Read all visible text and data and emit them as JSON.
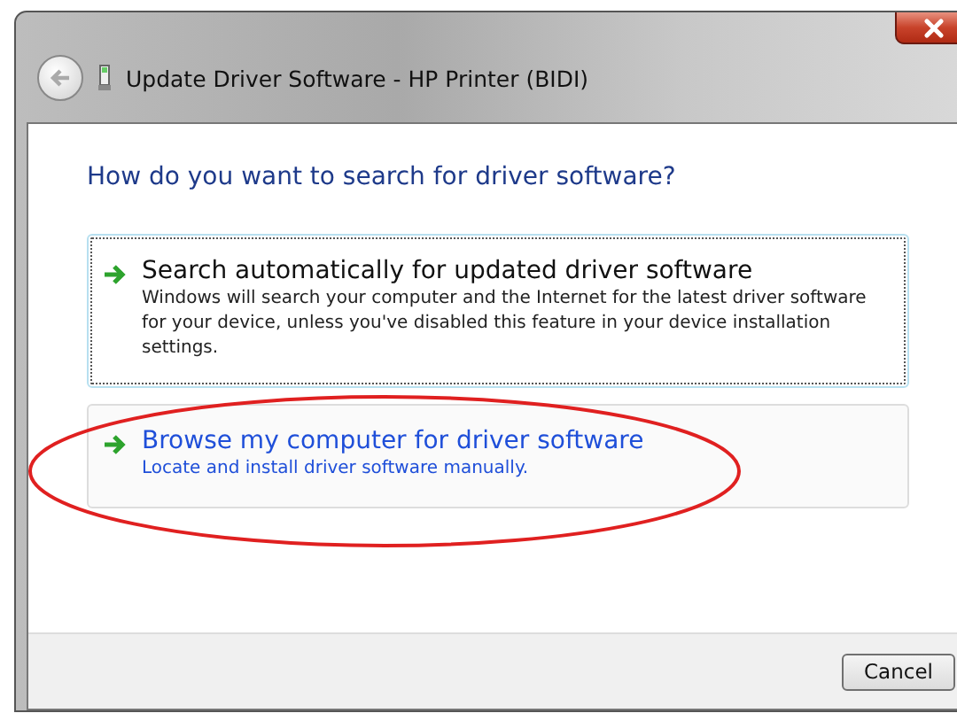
{
  "window": {
    "title": "Update Driver Software - HP Printer (BIDI)"
  },
  "heading": "How do you want to search for driver software?",
  "options": [
    {
      "title": "Search automatically for updated driver software",
      "description": "Windows will search your computer and the Internet for the latest driver software for your device, unless you've disabled this feature in your device installation settings.",
      "focused": true,
      "hovered": false
    },
    {
      "title": "Browse my computer for driver software",
      "description": "Locate and install driver software manually.",
      "focused": false,
      "hovered": true
    }
  ],
  "buttons": [
    "Cancel"
  ]
}
